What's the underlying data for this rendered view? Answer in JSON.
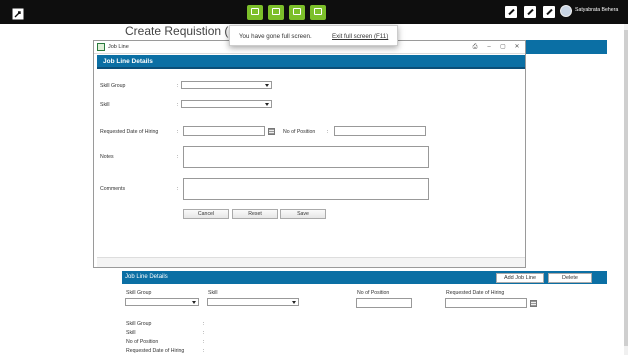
{
  "topbar": {
    "user_name": "Satyabrata Behera",
    "quick_buttons": [
      "flag-icon",
      "flag-icon",
      "flag-icon",
      "flag-icon"
    ],
    "right_icons": [
      "edit-icon",
      "edit-icon",
      "edit-icon"
    ]
  },
  "page": {
    "title": "Create Requistion (Skill"
  },
  "fullscreen": {
    "message": "You have gone full screen.",
    "exit_label": "Exit full screen (F11)"
  },
  "modal": {
    "title": "Job Line",
    "section_title": "Job Line Details",
    "window_buttons": [
      "⎙",
      "–",
      "▢",
      "✕"
    ],
    "fields": {
      "skill_group": {
        "label": "Skill Group",
        "value": ""
      },
      "skill": {
        "label": "Skill",
        "value": ""
      },
      "requested_date": {
        "label": "Requested Date of Hiring",
        "value": ""
      },
      "no_of_position": {
        "label": "No of Position",
        "value": ""
      },
      "notes": {
        "label": "Notes",
        "value": ""
      },
      "comments": {
        "label": "Comments",
        "value": ""
      }
    },
    "colon": ":",
    "buttons": {
      "cancel": "Cancel",
      "reset": "Reset",
      "save": "Save"
    }
  },
  "bottom": {
    "title": "Job Line Details",
    "add_label": "Add Job Line",
    "delete_label": "Delete",
    "columns": [
      "Skill Group",
      "Skill",
      "No of Position",
      "Requested Date of Hiring"
    ],
    "summary_labels": [
      "Skill Group",
      "Skill",
      "No of Position",
      "Requested Date of Hiring"
    ],
    "colon": ":"
  },
  "colors": {
    "accent": "#0b6fa4",
    "topbar": "#0e0e0e",
    "quick": "#7cbf2a"
  }
}
